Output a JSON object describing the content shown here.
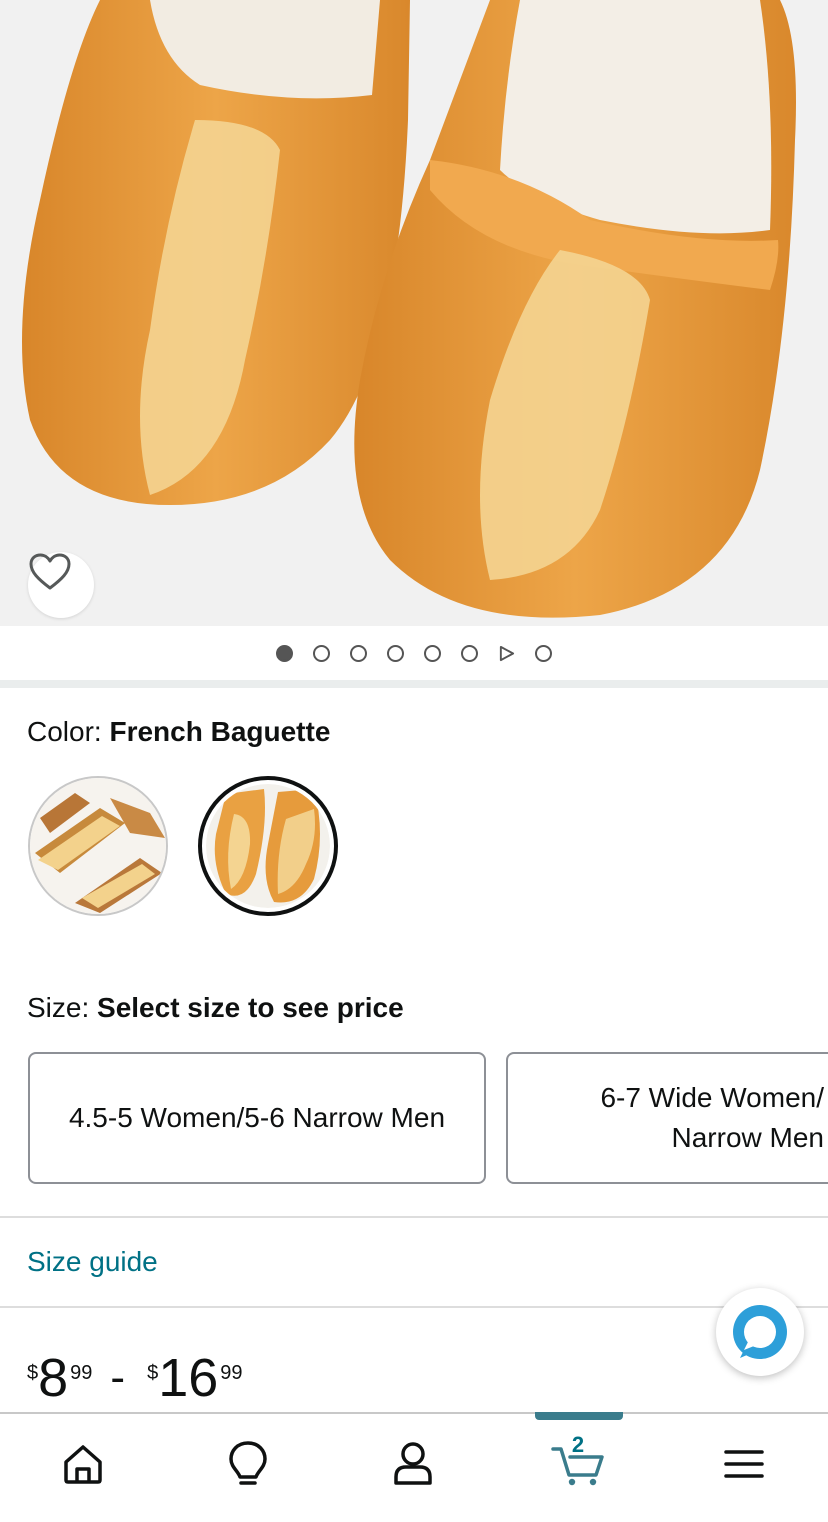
{
  "product": {
    "color_prefix": "Color: ",
    "color_value": "French Baguette",
    "size_prefix": "Size: ",
    "size_value": "Select size to see price",
    "size_options": [
      "4.5-5 Women/5-6 Narrow Men",
      "6-7 Wide Women/ Narrow Men"
    ],
    "size_guide": "Size guide",
    "price_low": {
      "symbol": "$",
      "whole": "8",
      "fraction": "99"
    },
    "price_separator": "-",
    "price_high": {
      "symbol": "$",
      "whole": "16",
      "fraction": "99"
    }
  },
  "carousel": {
    "total_dots": 8,
    "active_index": 0,
    "video_index": 6
  },
  "colors": {
    "link": "#007185",
    "text": "#0f1111",
    "accent": "#3a7c8c"
  },
  "nav": {
    "items": [
      "home-icon",
      "lightbulb-icon",
      "account-icon",
      "cart-icon",
      "menu-icon"
    ],
    "cart_count": "2",
    "active": "cart-icon"
  }
}
